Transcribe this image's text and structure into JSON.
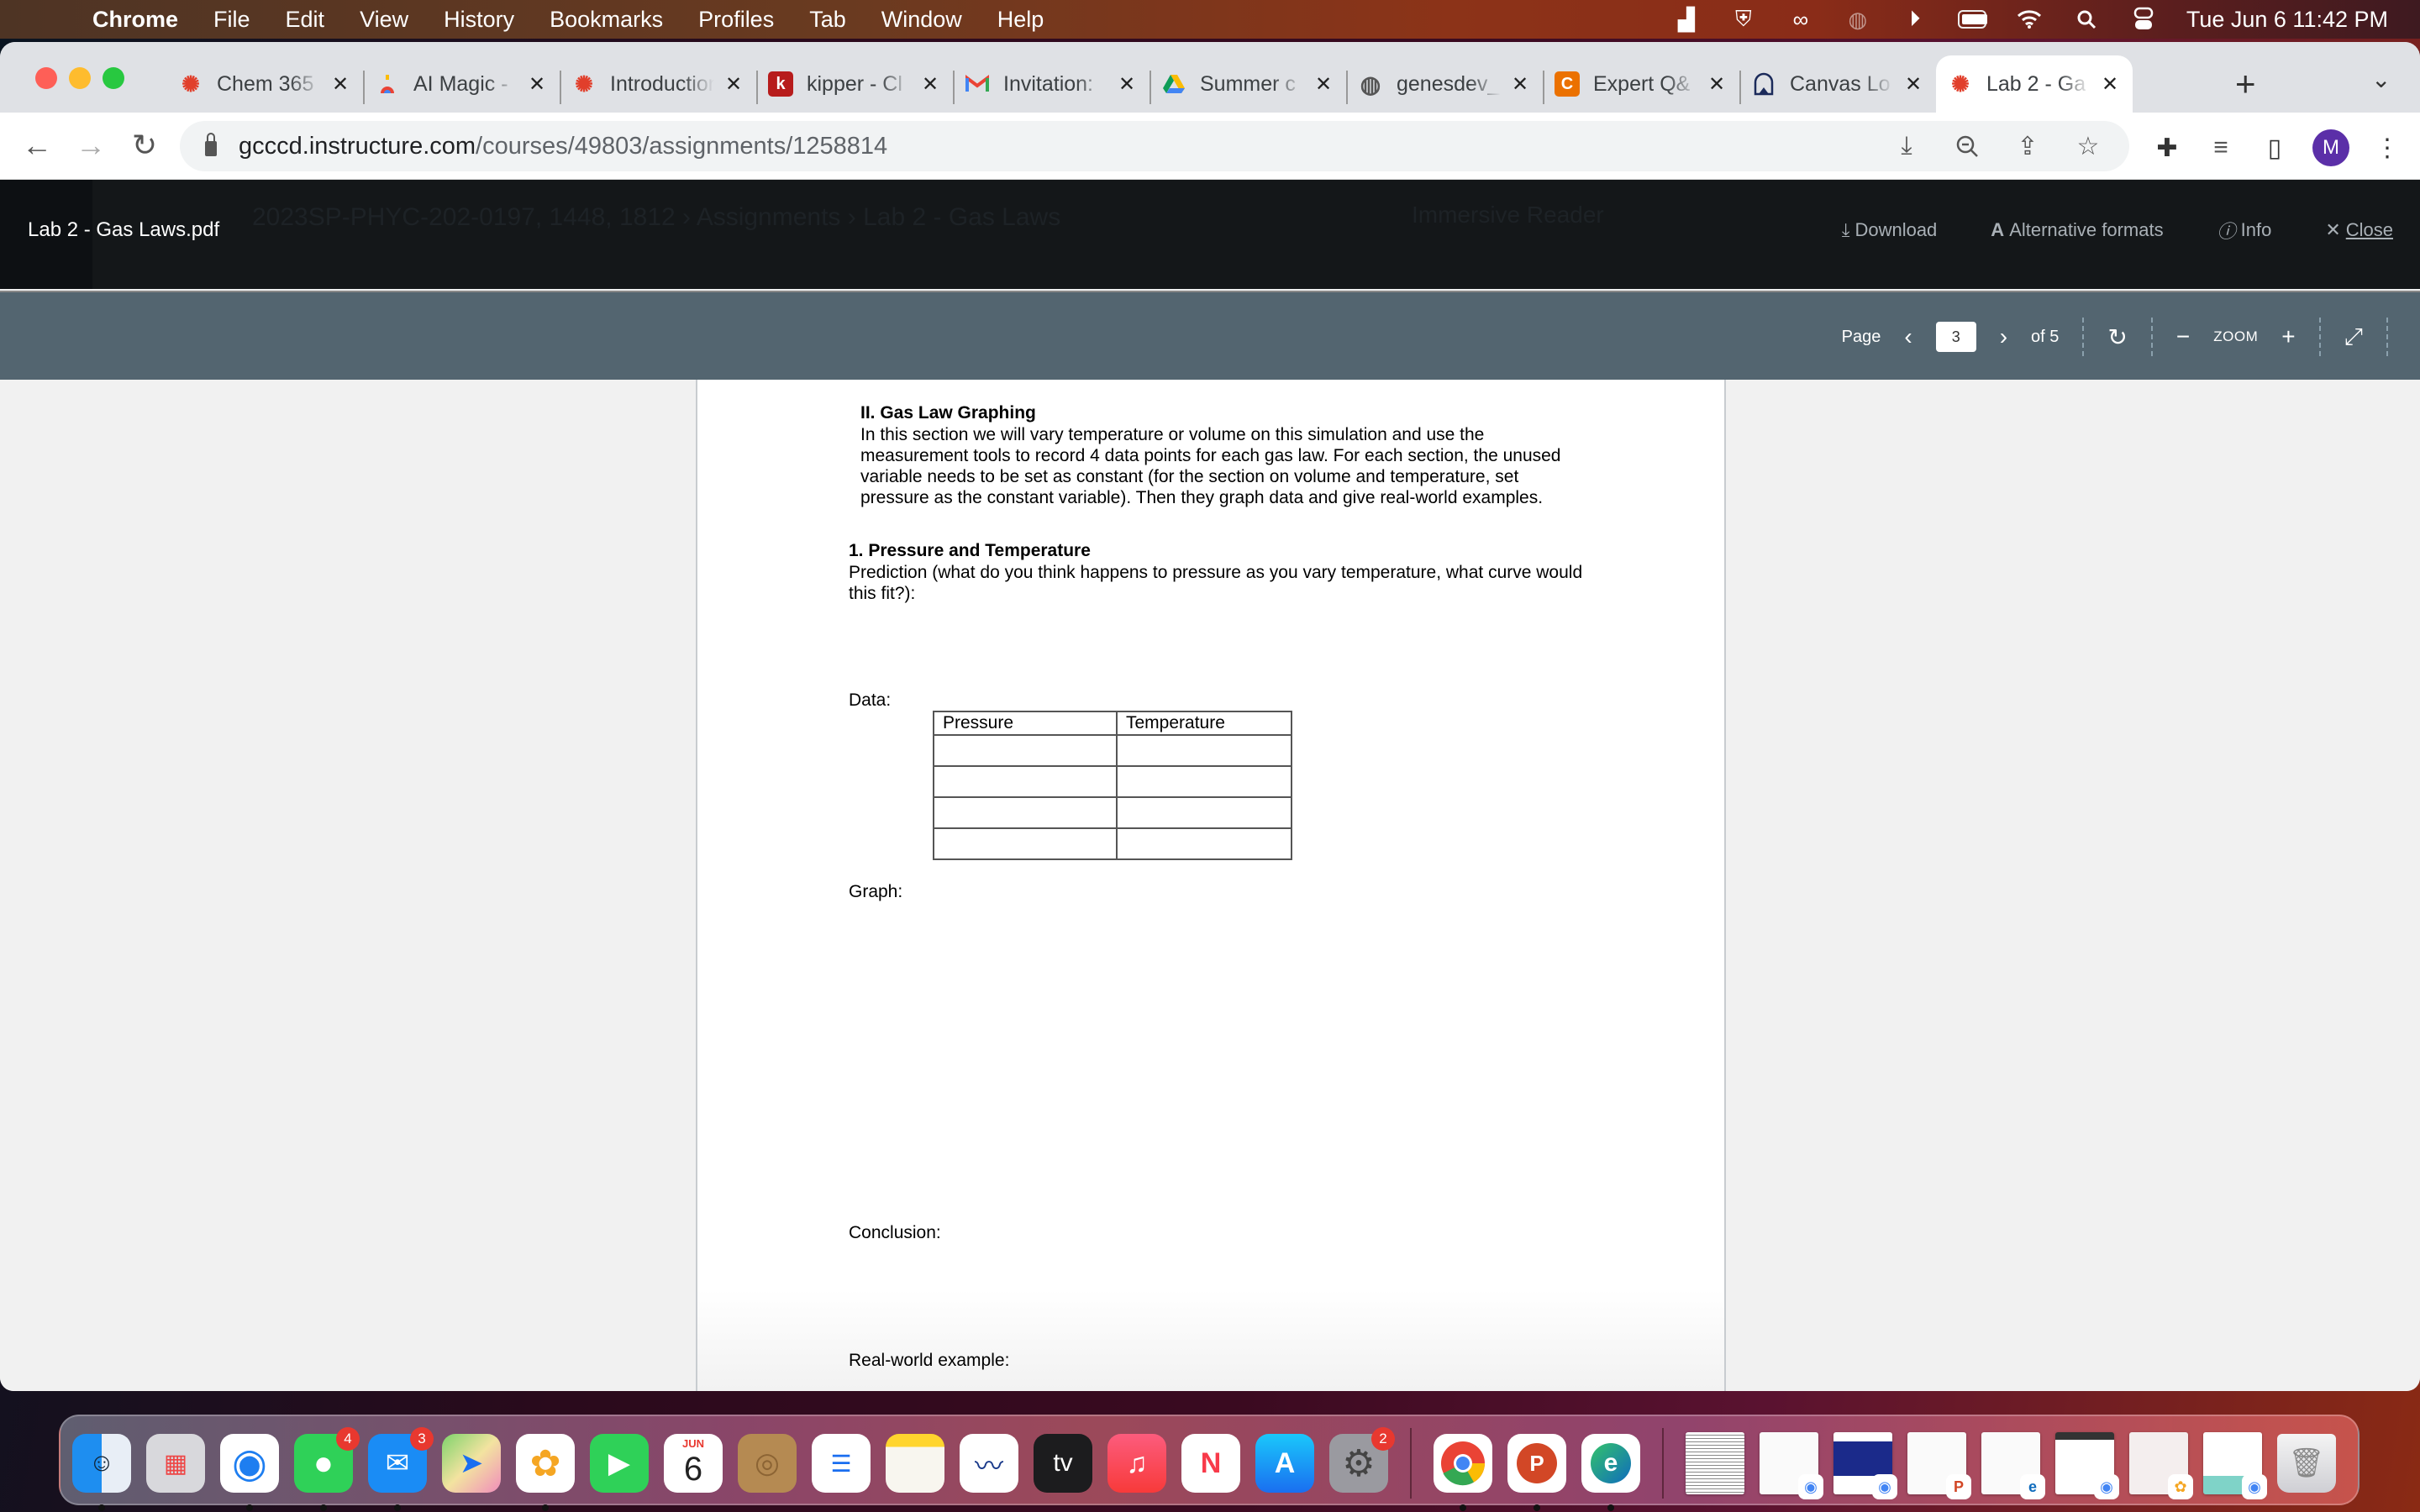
{
  "menubar": {
    "apple_icon": "apple-logo",
    "app_name": "Chrome",
    "items": [
      "File",
      "Edit",
      "View",
      "History",
      "Bookmarks",
      "Profiles",
      "Tab",
      "Window",
      "Help"
    ],
    "status_icons": [
      "notion-icon",
      "shield-check-icon",
      "creative-cloud-icon",
      "globe-icon",
      "play-circle-icon",
      "battery-icon",
      "wifi-icon",
      "search-icon",
      "control-center-icon"
    ],
    "clock": "Tue Jun 6  11:42 PM"
  },
  "browser": {
    "tabs": [
      {
        "title": "Chem 365",
        "icon": "canvas-icon",
        "icon_color": "#e13f2b",
        "active": false
      },
      {
        "title": "AI Magic -",
        "icon": "ai-magic-icon",
        "icon_color": "#4285f4",
        "active": false
      },
      {
        "title": "Introduction",
        "icon": "canvas-icon",
        "icon_color": "#e13f2b",
        "active": false
      },
      {
        "title": "kipper - Cl",
        "icon": "kipper-icon",
        "icon_color": "#b71c1c",
        "active": false
      },
      {
        "title": "Invitation:",
        "icon": "gmail-icon",
        "icon_color": "#ea4335",
        "active": false
      },
      {
        "title": "Summer c",
        "icon": "google-drive-icon",
        "icon_color": "#0f9d58",
        "active": false
      },
      {
        "title": "genesdev_",
        "icon": "globe-icon",
        "icon_color": "#555555",
        "active": false
      },
      {
        "title": "Expert Q&",
        "icon": "chegg-icon",
        "icon_color": "#eb7100",
        "active": false
      },
      {
        "title": "Canvas Lo",
        "icon": "canvas-login-icon",
        "icon_color": "#1b2a5a",
        "active": false
      },
      {
        "title": "Lab 2 - Ga",
        "icon": "canvas-icon",
        "icon_color": "#e13f2b",
        "active": true
      }
    ],
    "new_tab_label": "+",
    "tab_search_label": "⌄",
    "url_host": "gcccd.instructure.com",
    "url_path": "/courses/49803/assignments/1258814",
    "profile_initial": "M"
  },
  "viewer": {
    "file_name": "Lab 2 - Gas Laws.pdf",
    "background_breadcrumb": "2023SP-PHYC-202-0197, 1448, 1812  ›  Assignments  ›  Lab 2 - Gas Laws",
    "background_immersive_reader": "Immersive Reader",
    "actions": {
      "download": "Download",
      "alternative_formats": "Alternative formats",
      "info": "Info",
      "close": "Close"
    },
    "toolbar": {
      "page_label": "Page",
      "current_page": "3",
      "total_pages": "of 5",
      "zoom_label": "ZOOM"
    }
  },
  "document": {
    "section_title": "II. Gas Law Graphing",
    "section_intro": "In this section we will vary temperature or volume on this simulation and use the measurement tools to record 4 data points for each gas law. For each section, the unused variable needs to be set as constant (for the section on volume and temperature, set pressure as the constant variable). Then they graph data and give real-world examples.",
    "question_title": "1.  Pressure and Temperature",
    "question_prompt": "Prediction (what do you think happens to pressure as you vary temperature, what curve would this fit?):",
    "data_label": "Data:",
    "table": {
      "headers": [
        "Pressure",
        "Temperature"
      ],
      "rows": [
        [
          "",
          ""
        ],
        [
          "",
          ""
        ],
        [
          "",
          ""
        ],
        [
          "",
          ""
        ]
      ]
    },
    "graph_label": "Graph:",
    "conclusion_label": "Conclusion:",
    "real_world_label": "Real-world example:"
  },
  "dock": {
    "apps": [
      {
        "name": "Finder",
        "badge": null,
        "running": true
      },
      {
        "name": "Launchpad",
        "badge": null,
        "running": false
      },
      {
        "name": "Safari",
        "badge": null,
        "running": true
      },
      {
        "name": "Messages",
        "badge": "4",
        "running": true
      },
      {
        "name": "Mail",
        "badge": "3",
        "running": true
      },
      {
        "name": "Maps",
        "badge": null,
        "running": false
      },
      {
        "name": "Photos",
        "badge": null,
        "running": true
      },
      {
        "name": "FaceTime",
        "badge": null,
        "running": false
      },
      {
        "name": "Calendar",
        "badge": null,
        "running": false,
        "month": "JUN",
        "day": "6"
      },
      {
        "name": "Contacts",
        "badge": null,
        "running": false
      },
      {
        "name": "Reminders",
        "badge": null,
        "running": false
      },
      {
        "name": "Notes",
        "badge": null,
        "running": false
      },
      {
        "name": "Freeform",
        "badge": null,
        "running": false
      },
      {
        "name": "Apple TV",
        "badge": null,
        "running": false,
        "label": "tv"
      },
      {
        "name": "Music",
        "badge": null,
        "running": false
      },
      {
        "name": "News",
        "badge": null,
        "running": false
      },
      {
        "name": "App Store",
        "badge": null,
        "running": false
      },
      {
        "name": "System Settings",
        "badge": "2",
        "running": false
      },
      {
        "name": "Google Chrome",
        "badge": null,
        "running": true
      },
      {
        "name": "PowerPoint",
        "badge": null,
        "running": true
      },
      {
        "name": "Microsoft Edge",
        "badge": null,
        "running": true
      }
    ],
    "minimized_windows": [
      "document",
      "chrome",
      "chrome",
      "powerpoint",
      "edge",
      "chrome",
      "photos",
      "chrome"
    ],
    "trash_label": "Trash"
  }
}
